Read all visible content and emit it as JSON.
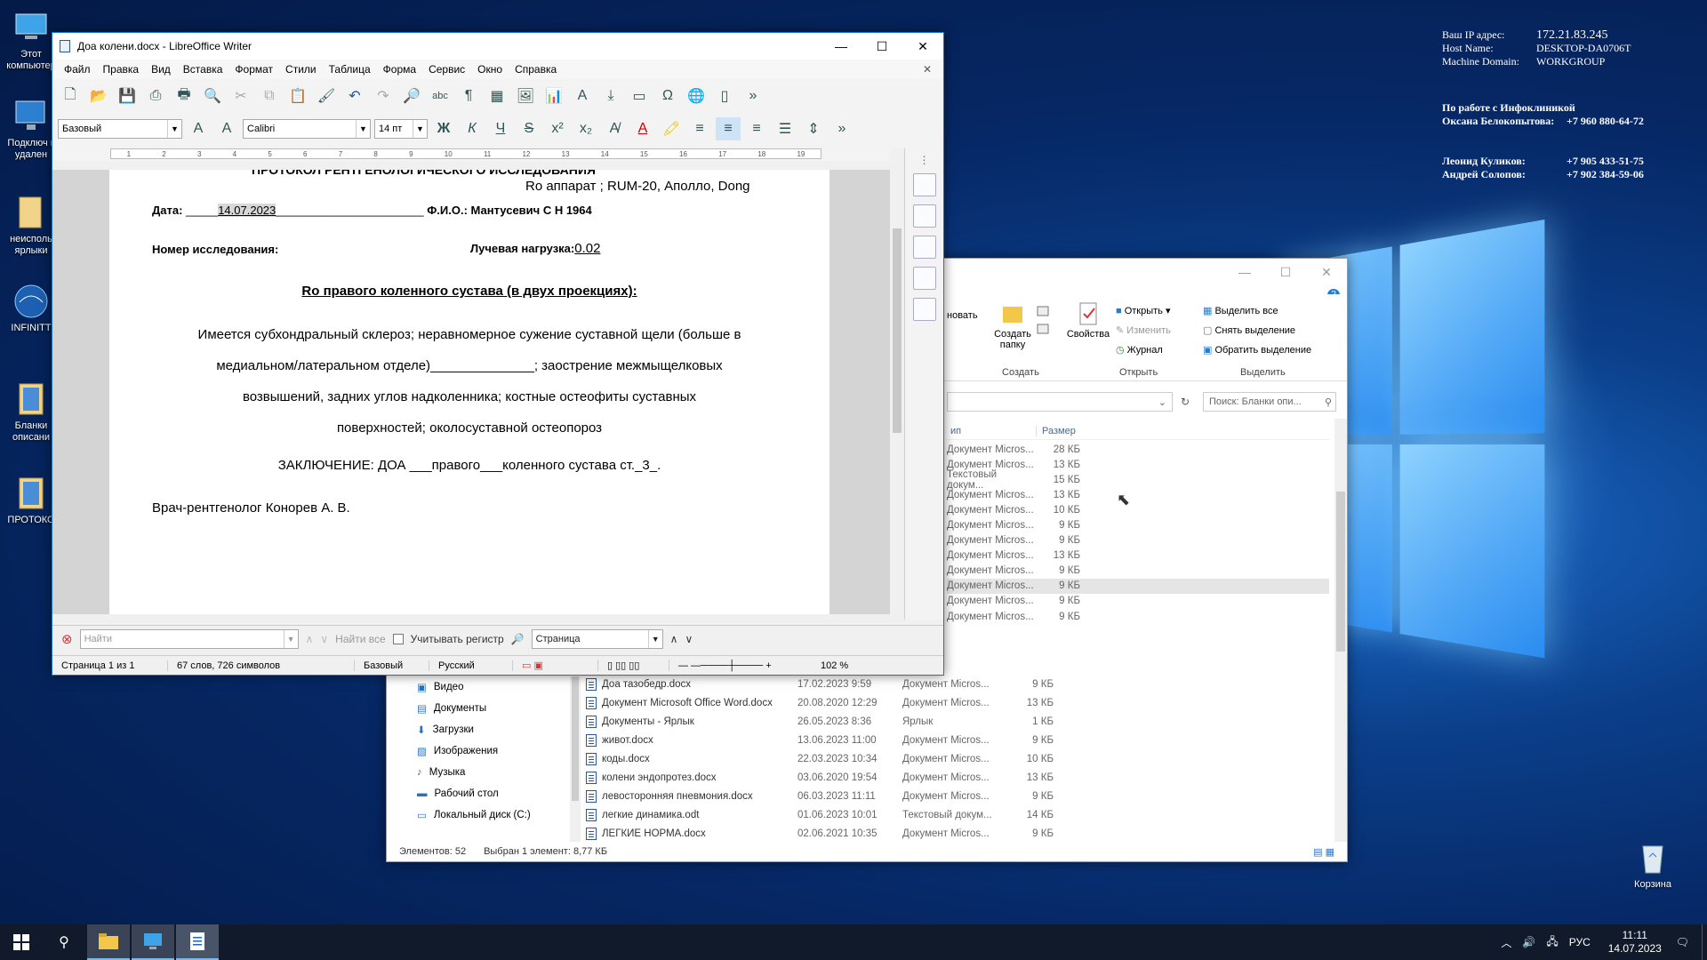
{
  "desktop": {
    "icons": [
      {
        "label": "Этот компьютер"
      },
      {
        "label": "Подключ к удален"
      },
      {
        "label": "неисполь ярлыки"
      },
      {
        "label": "INFINITT"
      },
      {
        "label": "Бланки описани"
      },
      {
        "label": "ПРОТОКО"
      },
      {
        "label": "Корзина"
      }
    ],
    "sysinfo": {
      "ip_label": "Ваш IP адрес:",
      "ip": "172.21.83.245",
      "host_label": "Host Name:",
      "host": "DESKTOP-DA0706T",
      "domain_label": "Machine Domain:",
      "domain": "WORKGROUP",
      "support_title": "По работе с Инфоклиникой",
      "support_name": "Оксана Белокопытова:",
      "support_phone": "+7 960 880-64-72",
      "c1_name": "Леонид Куликов:",
      "c1_phone": "+7 905 433-51-75",
      "c2_name": "Андрей Солопов:",
      "c2_phone": "+7 902 384-59-06"
    }
  },
  "writer": {
    "title": "Доа колени.docx - LibreOffice Writer",
    "menu": [
      "Файл",
      "Правка",
      "Вид",
      "Вставка",
      "Формат",
      "Стили",
      "Таблица",
      "Форма",
      "Сервис",
      "Окно",
      "Справка"
    ],
    "style_value": "Базовый",
    "font_value": "Calibri",
    "size_value": "14 пт",
    "ruler_marks": [
      "1",
      "2",
      "3",
      "4",
      "5",
      "6",
      "7",
      "8",
      "9",
      "10",
      "11",
      "12",
      "13",
      "14",
      "15",
      "16",
      "17",
      "18",
      "19"
    ],
    "doc": {
      "top_cut": "ПРОТОКОЛ РЕНТГЕНОЛОГИЧЕСКОГО ИССЛЕДОВАНИЯ",
      "apparatus": "Ro аппарат ; RUM-20,  Аполло, Dong",
      "date_label": "Дата:",
      "date_pre": "_____",
      "date_value": "14.07.2023",
      "date_post": "_______________________",
      "fio_label": "Ф.И.О.:",
      "fio_value": "Мантусевич С Н 1964",
      "study_label": "Номер исследования:",
      "dose_label": "Лучевая нагрузка:",
      "dose_value": "0.02",
      "heading": "Ro     правого     коленного сустава (в двух проекциях):",
      "body_line1": "Имеется субхондральный склероз; неравномерное сужение суставной щели (больше в",
      "body_line2": "медиальном/латеральном отделе)______________; заострение межмыщелковых",
      "body_line3": "возвышений, задних углов надколенника; костные остеофиты суставных",
      "body_line4": "поверхностей; околосуставной остеопороз",
      "conclusion": "ЗАКЛЮЧЕНИЕ: ДОА ___правого___коленного сустава ст._3_.",
      "doctor": "Врач-рентгенолог Конорев А. В."
    },
    "find": {
      "placeholder": "Найти",
      "find_all": "Найти все",
      "match_case": "Учитывать регистр",
      "scope": "Страница"
    },
    "status": {
      "page": "Страница 1 из 1",
      "words": "67 слов, 726 символов",
      "style": "Базовый",
      "lang": "Русский",
      "zoom": "102 %"
    }
  },
  "explorer": {
    "ribbon": {
      "btn_cut": "новать",
      "btn_new_folder": "Создать папку",
      "grp_create": "Создать",
      "btn_props": "Свойства",
      "btn_open": "Открыть",
      "btn_edit": "Изменить",
      "btn_history": "Журнал",
      "grp_open": "Открыть",
      "btn_select_all": "Выделить все",
      "btn_select_none": "Снять выделение",
      "btn_invert": "Обратить выделение",
      "grp_select": "Выделить"
    },
    "search_placeholder": "Поиск: Бланки опи...",
    "columns": {
      "type": "ип",
      "size": "Размер"
    },
    "rows_top": [
      {
        "type": "Документ Micros...",
        "size": "28 КБ"
      },
      {
        "type": "Документ Micros...",
        "size": "13 КБ"
      },
      {
        "type": "Текстовый докум...",
        "size": "15 КБ"
      },
      {
        "type": "Документ Micros...",
        "size": "13 КБ"
      },
      {
        "type": "Документ Micros...",
        "size": "10 КБ"
      },
      {
        "type": "Документ Micros...",
        "size": "9 КБ"
      },
      {
        "type": "Документ Micros...",
        "size": "9 КБ"
      },
      {
        "type": "Документ Micros...",
        "size": "13 КБ"
      },
      {
        "type": "Документ Micros...",
        "size": "9 КБ"
      },
      {
        "type": "Документ Micros...",
        "size": "9 КБ"
      },
      {
        "type": "Документ Micros...",
        "size": "9 КБ"
      },
      {
        "type": "Документ Micros...",
        "size": "9 КБ"
      }
    ],
    "rows": [
      {
        "name": "Доа тазобедр.docx",
        "date": "17.02.2023 9:59",
        "type": "Документ Micros...",
        "size": "9 КБ"
      },
      {
        "name": "Документ Microsoft Office Word.docx",
        "date": "20.08.2020 12:29",
        "type": "Документ Micros...",
        "size": "13 КБ"
      },
      {
        "name": "Документы - Ярлык",
        "date": "26.05.2023 8:36",
        "type": "Ярлык",
        "size": "1 КБ"
      },
      {
        "name": "живот.docx",
        "date": "13.06.2023 11:00",
        "type": "Документ Micros...",
        "size": "9 КБ"
      },
      {
        "name": "коды.docx",
        "date": "22.03.2023 10:34",
        "type": "Документ Micros...",
        "size": "10 КБ"
      },
      {
        "name": "колени эндопротез.docx",
        "date": "03.06.2020 19:54",
        "type": "Документ Micros...",
        "size": "13 КБ"
      },
      {
        "name": "левосторонняя пневмония.docx",
        "date": "06.03.2023 11:11",
        "type": "Документ Micros...",
        "size": "9 КБ"
      },
      {
        "name": "легкие динамика.odt",
        "date": "01.06.2023 10:01",
        "type": "Текстовый докум...",
        "size": "14 КБ"
      },
      {
        "name": "ЛЕГКИЕ НОРМА.docx",
        "date": "02.06.2021 10:35",
        "type": "Документ Micros...",
        "size": "9 КБ"
      }
    ],
    "nav": [
      "Видео",
      "Документы",
      "Загрузки",
      "Изображения",
      "Музыка",
      "Рабочий стол",
      "Локальный диск (C:)"
    ],
    "status_count": "Элементов: 52",
    "status_selected": "Выбран 1 элемент: 8,77 КБ"
  },
  "taskbar": {
    "lang": "РУС",
    "time": "11:11",
    "date": "14.07.2023"
  }
}
